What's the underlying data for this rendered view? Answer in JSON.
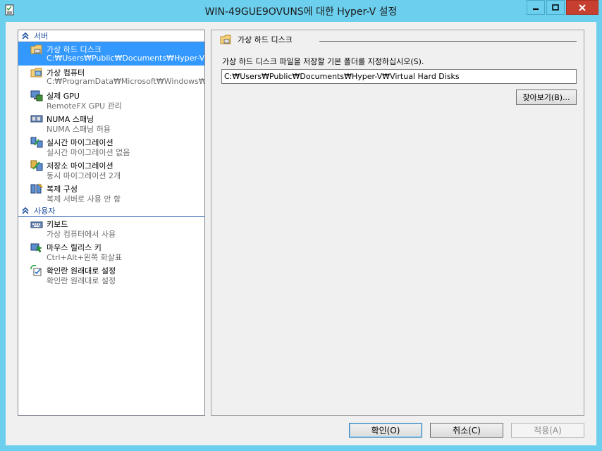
{
  "window": {
    "title": "WIN-49GUE9OVUNS에 대한 Hyper-V 설정"
  },
  "sidebar": {
    "sections": [
      {
        "header": "서버",
        "items": [
          {
            "title": "가상 하드 디스크",
            "subtitle": "C:₩Users₩Public₩Documents₩Hyper-V...",
            "icon": "folder-disk-icon",
            "selected": true
          },
          {
            "title": "가상 컴퓨터",
            "subtitle": "C:₩ProgramData₩Microsoft₩Windows₩...",
            "icon": "folder-vm-icon"
          },
          {
            "title": "실제 GPU",
            "subtitle": "RemoteFX GPU 관리",
            "icon": "gpu-icon"
          },
          {
            "title": "NUMA 스패닝",
            "subtitle": "NUMA 스패닝 허용",
            "icon": "numa-icon"
          },
          {
            "title": "실시간 마이그레이션",
            "subtitle": "실시간 마이그레이션 없음",
            "icon": "live-migration-icon"
          },
          {
            "title": "저장소 마이그레이션",
            "subtitle": "동시 마이그레이션 2개",
            "icon": "storage-migration-icon"
          },
          {
            "title": "복제 구성",
            "subtitle": "복제 서버로 사용 안 함",
            "icon": "replication-icon"
          }
        ]
      },
      {
        "header": "사용자",
        "items": [
          {
            "title": "키보드",
            "subtitle": "가상 컴퓨터에서 사용",
            "icon": "keyboard-icon"
          },
          {
            "title": "마우스 릴리스 키",
            "subtitle": "Ctrl+Alt+왼쪽 화살표",
            "icon": "mouse-release-icon"
          },
          {
            "title": "확인란 원래대로 설정",
            "subtitle": "확인란 원래대로 설정",
            "icon": "checkbox-reset-icon"
          }
        ]
      }
    ]
  },
  "main": {
    "group_title": "가상 하드 디스크",
    "description": "가상 하드 디스크 파일을 저장할 기본 폴더를 지정하십시오(S).",
    "path_value": "C:₩Users₩Public₩Documents₩Hyper-V₩Virtual Hard Disks",
    "browse_label": "찾아보기(B)..."
  },
  "footer": {
    "ok_label": "확인(O)",
    "cancel_label": "취소(C)",
    "apply_label": "적용(A)"
  },
  "colors": {
    "title_bar": "#6ccfee",
    "selection": "#3399ff",
    "close_button": "#c7402f",
    "section_header": "#1e4f9c"
  }
}
